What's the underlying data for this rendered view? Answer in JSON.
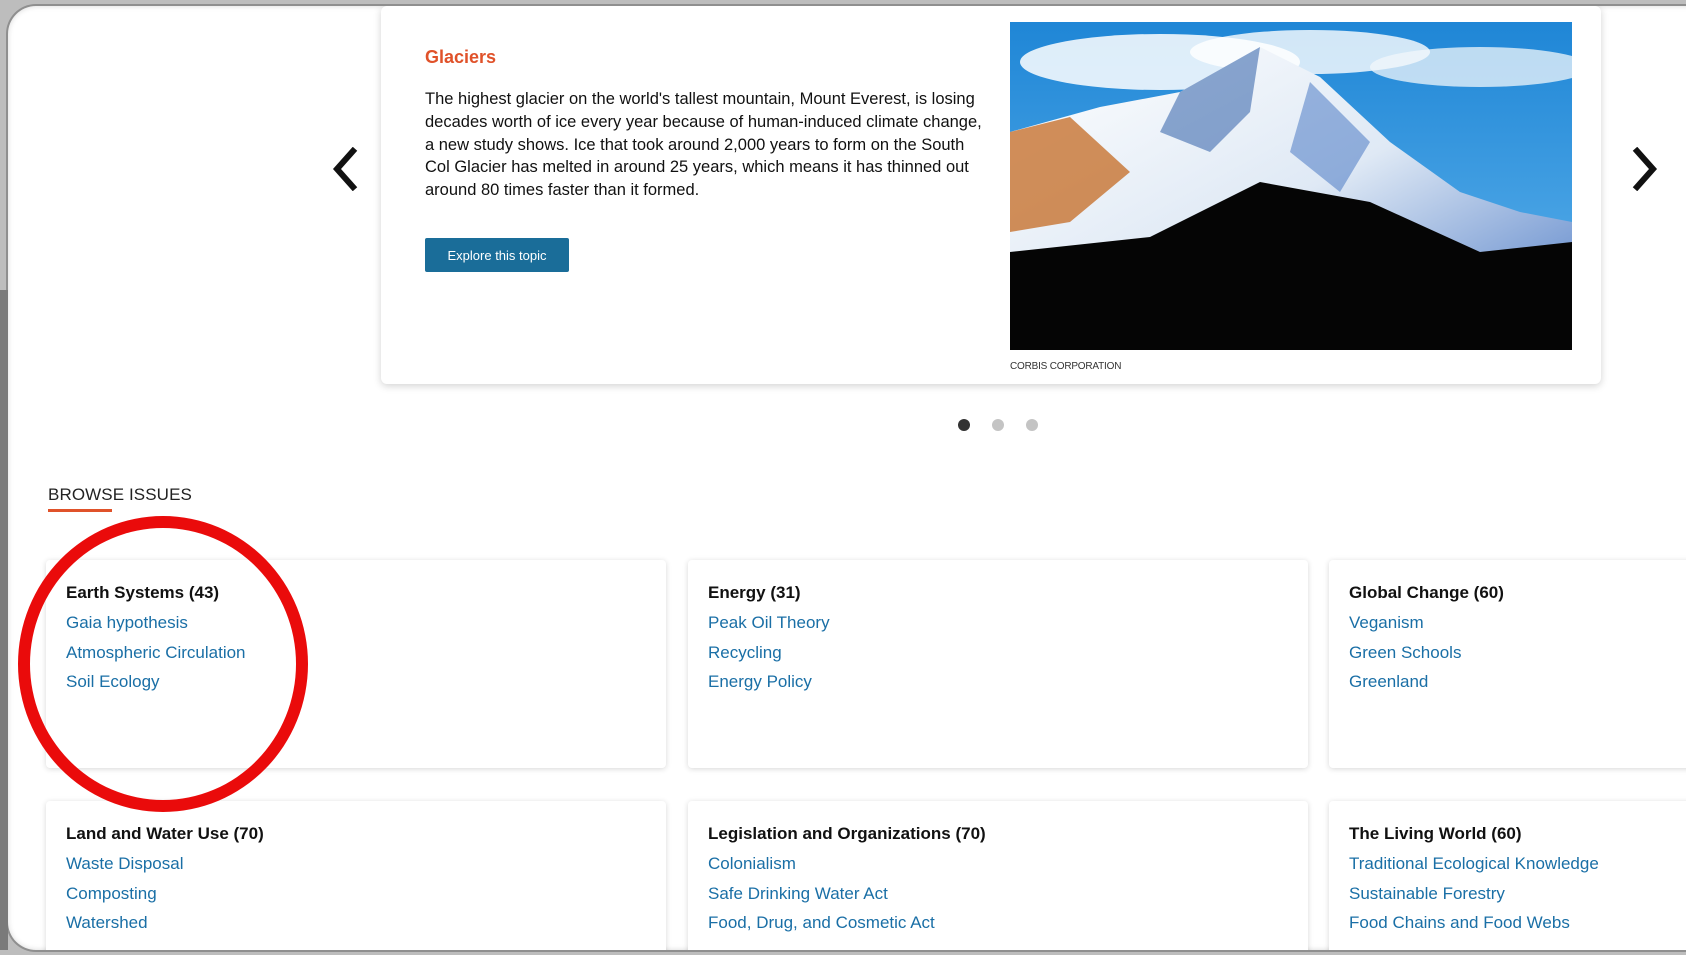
{
  "carousel": {
    "title": "Glaciers",
    "text": "The highest glacier on the world's tallest mountain, Mount Everest, is losing decades worth of ice every year because of human-induced climate change, a new study shows. Ice that took around 2,000 years to form on the South Col Glacier has melted in around 25 years, which means it has thinned out around 80 times faster than it formed.",
    "button_label": "Explore this topic",
    "image_credit": "CORBIS CORPORATION",
    "active_slide": 1,
    "slide_count": 3
  },
  "browse": {
    "heading": "BROWSE ISSUES",
    "categories": [
      {
        "title": "Earth Systems (43)",
        "links": [
          "Gaia hypothesis",
          "Atmospheric Circulation",
          "Soil Ecology"
        ]
      },
      {
        "title": "Energy (31)",
        "links": [
          "Peak Oil Theory",
          "Recycling",
          "Energy Policy"
        ]
      },
      {
        "title": "Global Change (60)",
        "links": [
          "Veganism",
          "Green Schools",
          "Greenland"
        ]
      },
      {
        "title": "Land and Water Use (70)",
        "links": [
          "Waste Disposal",
          "Composting",
          "Watershed"
        ]
      },
      {
        "title": "Legislation and Organizations (70)",
        "links": [
          "Colonialism",
          "Safe Drinking Water Act",
          "Food, Drug, and Cosmetic Act"
        ]
      },
      {
        "title": "The Living World (60)",
        "links": [
          "Traditional Ecological Knowledge",
          "Sustainable Forestry",
          "Food Chains and Food Webs"
        ]
      }
    ]
  },
  "colors": {
    "accent": "#e0522a",
    "link": "#1a6fa6",
    "button": "#1a6d99",
    "annotation": "#ea0b0b"
  }
}
